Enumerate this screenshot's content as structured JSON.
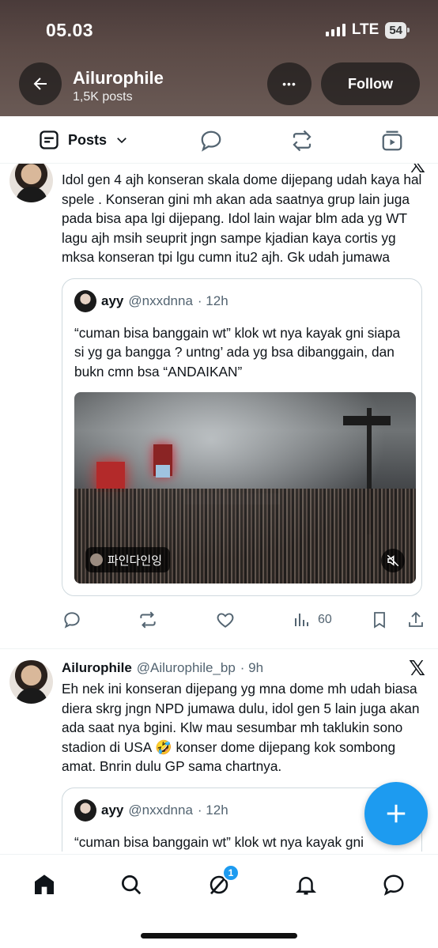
{
  "status_bar": {
    "time": "05.03",
    "network": "LTE",
    "battery": "54"
  },
  "header": {
    "title": "Ailurophile",
    "subtitle": "1,5K posts",
    "follow_label": "Follow",
    "more_label": "•••"
  },
  "tabs": {
    "posts_label": "Posts"
  },
  "tweet1": {
    "text": "Idol gen 4 ajh konseran skala dome dijepang udah kaya hal spele . Konseran gini mh akan ada saatnya grup lain juga pada bisa apa lgi dijepang. Idol lain wajar blm ada yg WT lagu ajh msih seuprit jngn sampe kjadian kaya cortis yg mksa konseran tpi lgu cumn itu2 ajh. Gk udah jumawa",
    "quote": {
      "name": "ayy",
      "handle": "@nxxdnna",
      "time": "· 12h",
      "text": "“cuman bisa banggain wt” klok wt nya kayak gni siapa si yg ga bangga ? untng’ ada yg bsa dibanggain, dan bukn cmn bsa “ANDAIKAN”",
      "media_badge": "파인다인잉"
    },
    "views": "60"
  },
  "tweet2": {
    "name": "Ailurophile",
    "handle": "@Ailurophile_bp",
    "time": "· 9h",
    "text": "Eh nek ini konseran dijepang yg mna dome mh udah biasa diera skrg jngn NPD jumawa dulu, idol gen 5 lain juga akan ada saat nya bgini. Klw mau sesumbar mh taklukin sono stadion di USA 🤣 konser dome dijepang kok sombong amat. Bnrin dulu GP sama chartnya.",
    "quote": {
      "name": "ayy",
      "handle": "@nxxdnna",
      "time": "· 12h",
      "text": "“cuman bisa banggain wt” klok wt nya kayak gni"
    }
  },
  "bottom_nav": {
    "messages_badge": "1"
  },
  "colors": {
    "accent": "#1d9bf0",
    "muted": "#536471",
    "text": "#0f1419"
  }
}
